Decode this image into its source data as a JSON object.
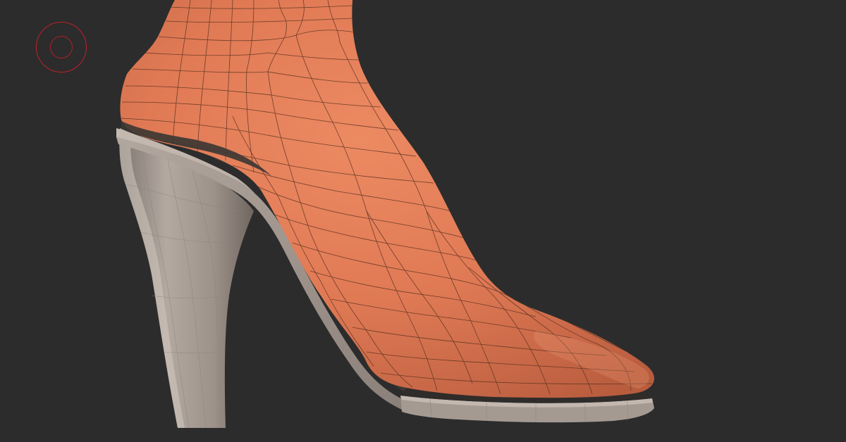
{
  "viewport": {
    "background": "#2c2c2c",
    "cursor_icon": "brush-cursor-icon"
  },
  "scene": {
    "objects": [
      {
        "name": "foot-mesh",
        "material_color": "#e07a55",
        "wire_color": "#5a3220",
        "topology": "quad-polygroup-wireframe"
      },
      {
        "name": "high-heel-shoe",
        "material_color": "#9e928a",
        "shading": "flat-faceted"
      }
    ]
  }
}
